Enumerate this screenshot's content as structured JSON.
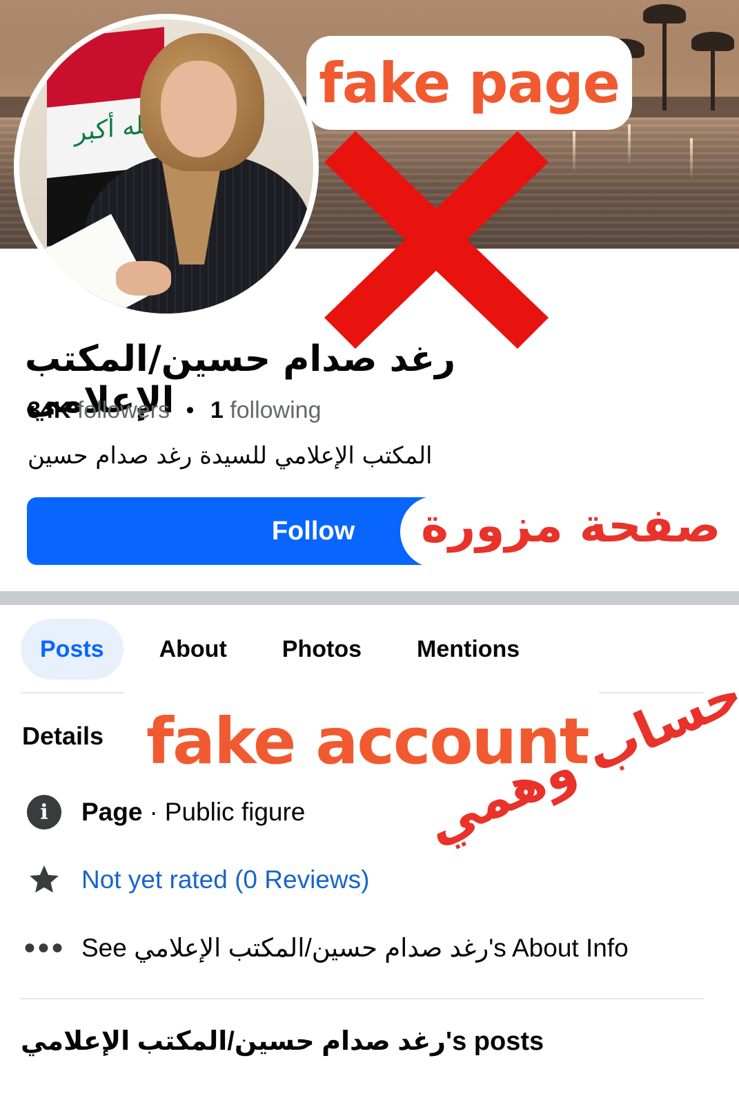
{
  "overlay": {
    "fake_page_label": "fake page",
    "fake_page_arabic": "صفحة مزورة",
    "fake_account_label": "fake account",
    "fake_account_arabic": "حساب وهمي"
  },
  "profile": {
    "name": "رغد صدام حسين/المكتب الإعلامي",
    "followers_count": "34K",
    "followers_label": "followers",
    "separator": "•",
    "following_count": "1",
    "following_label": "following",
    "bio": "المكتب الإعلامي للسيدة رغد صدام حسين",
    "follow_button": "Follow"
  },
  "tabs": [
    "Posts",
    "About",
    "Photos",
    "Mentions"
  ],
  "details": {
    "title": "Details",
    "page_label": "Page",
    "page_separator": "·",
    "page_category": "Public figure",
    "rating_text": "Not yet rated (0 Reviews)",
    "about_info": "See رغد صدام حسين/المكتب الإعلامي's About Info"
  },
  "posts_section": {
    "title": "رغد صدام حسين/المكتب الإعلامي's posts"
  },
  "colors": {
    "accent": "#0866ff",
    "link": "#1763cf",
    "warning_orange": "#f15a30",
    "warning_red": "#e8322a"
  },
  "icons": [
    "info-icon",
    "star-icon",
    "more-dots-icon",
    "red-x-icon"
  ]
}
